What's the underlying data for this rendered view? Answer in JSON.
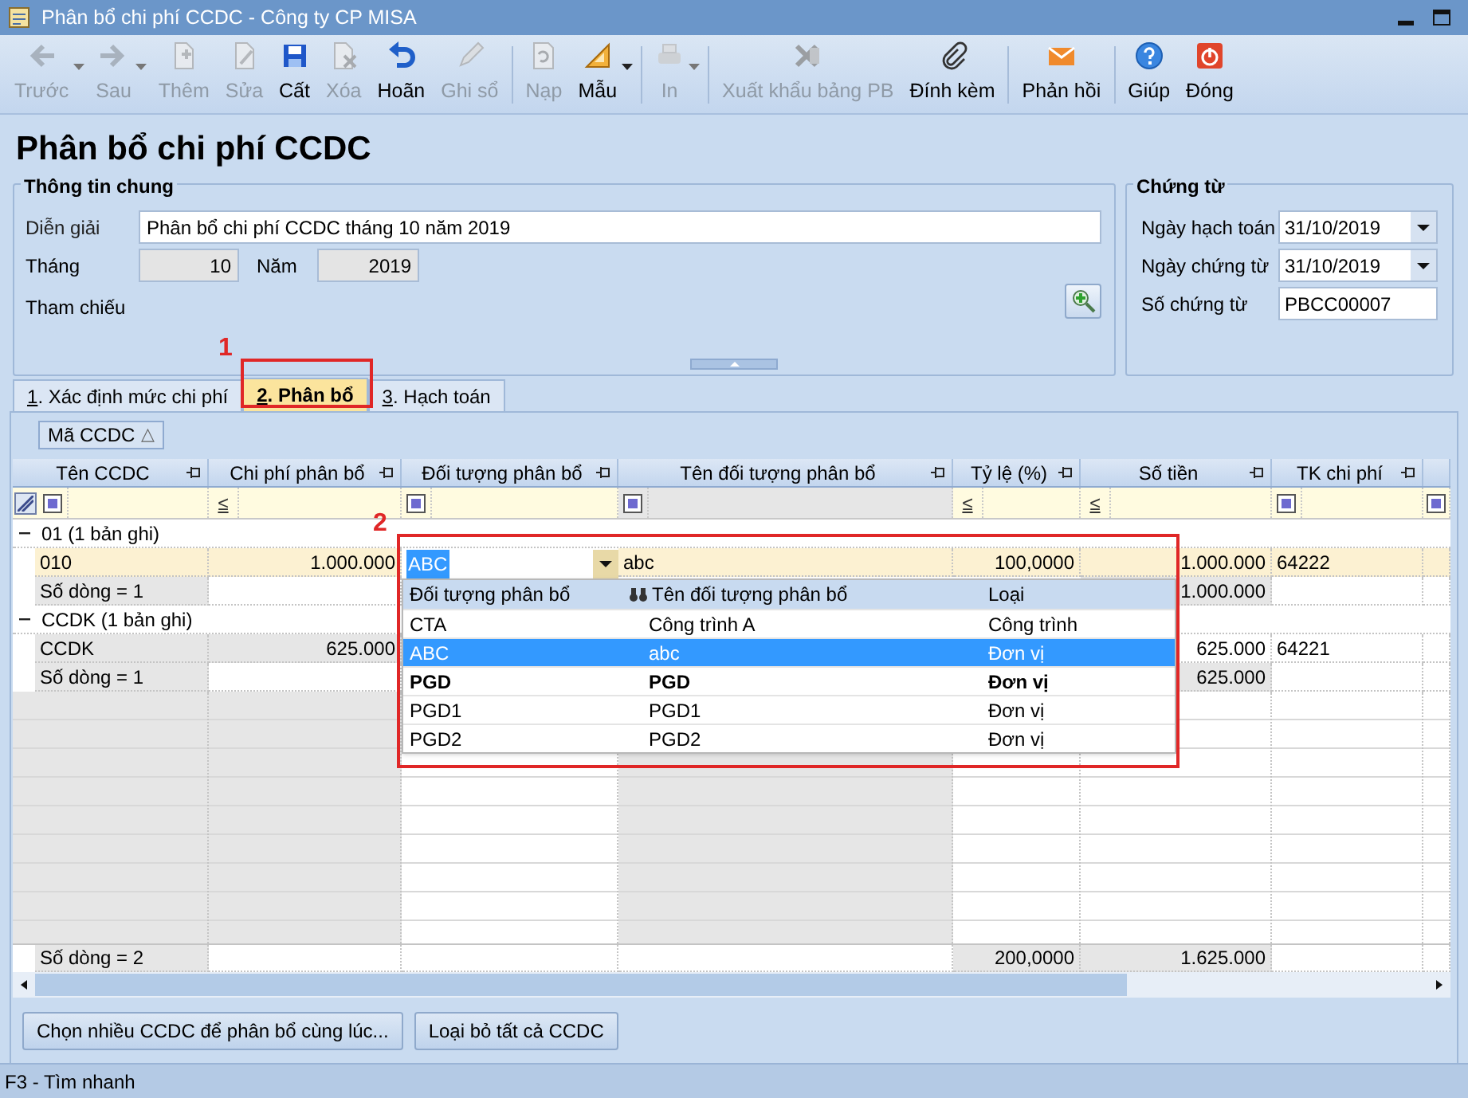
{
  "window": {
    "title": "Phân bổ chi phí CCDC - Công ty CP MISA"
  },
  "toolbar": [
    {
      "kind": "button",
      "label": "Trước",
      "disabled": true,
      "has_menu": true
    },
    {
      "kind": "button",
      "label": "Sau",
      "disabled": true,
      "has_menu": true
    },
    {
      "kind": "button",
      "label": "Thêm",
      "disabled": true,
      "has_menu": false
    },
    {
      "kind": "button",
      "label": "Sửa",
      "disabled": true,
      "has_menu": false
    },
    {
      "kind": "button",
      "label": "Cất",
      "disabled": false,
      "has_menu": false
    },
    {
      "kind": "button",
      "label": "Xóa",
      "disabled": true,
      "has_menu": false
    },
    {
      "kind": "button",
      "label": "Hoãn",
      "disabled": false,
      "has_menu": false
    },
    {
      "kind": "button",
      "label": "Ghi sổ",
      "disabled": true,
      "has_menu": false
    },
    {
      "kind": "separator"
    },
    {
      "kind": "button",
      "label": "Nạp",
      "disabled": true,
      "has_menu": false
    },
    {
      "kind": "button",
      "label": "Mẫu",
      "disabled": false,
      "has_menu": true
    },
    {
      "kind": "separator"
    },
    {
      "kind": "button",
      "label": "In",
      "disabled": true,
      "has_menu": true
    },
    {
      "kind": "separator"
    },
    {
      "kind": "button",
      "label": "Xuất khẩu bảng PB",
      "disabled": true,
      "has_menu": false
    },
    {
      "kind": "button",
      "label": "Đính kèm",
      "disabled": false,
      "has_menu": false
    },
    {
      "kind": "separator"
    },
    {
      "kind": "button",
      "label": "Phản hồi",
      "disabled": false,
      "has_menu": false
    },
    {
      "kind": "separator"
    },
    {
      "kind": "button",
      "label": "Giúp",
      "disabled": false,
      "has_menu": false
    },
    {
      "kind": "button",
      "label": "Đóng",
      "disabled": false,
      "has_menu": false
    }
  ],
  "page_title": "Phân bổ chi phí CCDC",
  "general_info": {
    "legend": "Thông tin chung",
    "description": {
      "label": "Diễn giải",
      "value": "Phân bổ chi phí CCDC tháng 10 năm 2019"
    },
    "month": {
      "label": "Tháng",
      "value": "10"
    },
    "year": {
      "label": "Năm",
      "value": "2019"
    },
    "reference": {
      "label": "Tham chiếu"
    }
  },
  "voucher": {
    "legend": "Chứng từ",
    "fields": [
      {
        "kind": "date",
        "label": "Ngày hạch toán",
        "value": "31/10/2019"
      },
      {
        "kind": "date",
        "label": "Ngày chứng từ",
        "value": "31/10/2019"
      },
      {
        "kind": "text",
        "label": "Số chứng từ",
        "value": "PBCC00007"
      }
    ]
  },
  "tabs": [
    {
      "label": "1. Xác định mức chi phí",
      "selected": false
    },
    {
      "label": "2. Phân bổ",
      "selected": true
    },
    {
      "label": "3. Hạch toán",
      "selected": false
    }
  ],
  "group_by": {
    "label": "Mã CCDC",
    "sort": "△"
  },
  "table": {
    "columns": [
      "Tên CCDC",
      "Chi phí phân bổ",
      "Đối tượng phân bổ",
      "Tên đối tượng phân bổ",
      "Tỷ lệ (%)",
      "Số tiền",
      "TK chi phí"
    ],
    "filter_row": [
      {
        "kind": "box"
      },
      {
        "kind": "symbol",
        "text": "≤"
      },
      {
        "kind": "box"
      },
      {
        "kind": "box"
      },
      {
        "kind": "symbol",
        "text": "≤"
      },
      {
        "kind": "symbol",
        "text": "≤"
      },
      {
        "kind": "box"
      },
      {
        "kind": "box"
      }
    ],
    "groups": [
      {
        "title": "01 (1 bản ghi)",
        "expanded": true,
        "rows": [
          {
            "selected": true,
            "cells": [
              "010",
              "1.000.000",
              "ABC",
              "abc",
              "100,0000",
              "1.000.000",
              "64222"
            ]
          }
        ],
        "summary": {
          "label": "Số dòng = 1",
          "amount": "1.000.000"
        }
      },
      {
        "title": "CCDK (1 bản ghi)",
        "expanded": true,
        "rows": [
          {
            "selected": false,
            "cells": [
              "CCDK",
              "625.000",
              null,
              null,
              null,
              "625.000",
              "64221"
            ]
          }
        ],
        "summary": {
          "label": "Số dòng = 1",
          "amount": "625.000"
        }
      }
    ],
    "footer": {
      "label": "Số dòng = 2",
      "ratio": "200,0000",
      "amount": "1.625.000"
    }
  },
  "dropdown": {
    "columns": [
      "Đối tượng phân bổ",
      "Tên đối tượng phân bổ",
      "Loại"
    ],
    "rows": [
      {
        "code": "CTA",
        "name": "Công trình A",
        "type": "Công trình",
        "selected": false,
        "bold": false
      },
      {
        "code": "ABC",
        "name": "abc",
        "type": "Đơn vị",
        "selected": true,
        "bold": false
      },
      {
        "code": "PGD",
        "name": "PGD",
        "type": "Đơn vị",
        "selected": false,
        "bold": true
      },
      {
        "code": "PGD1",
        "name": "PGD1",
        "type": "Đơn vị",
        "selected": false,
        "bold": false
      },
      {
        "code": "PGD2",
        "name": "PGD2",
        "type": "Đơn vị",
        "selected": false,
        "bold": false
      }
    ]
  },
  "annotations": [
    {
      "label": "1"
    },
    {
      "label": "2"
    }
  ],
  "buttons": [
    "Chọn nhiều CCDC để phân bổ cùng lúc...",
    "Loại bỏ tất cả CCDC"
  ],
  "status_bar": "F3 - Tìm nhanh"
}
